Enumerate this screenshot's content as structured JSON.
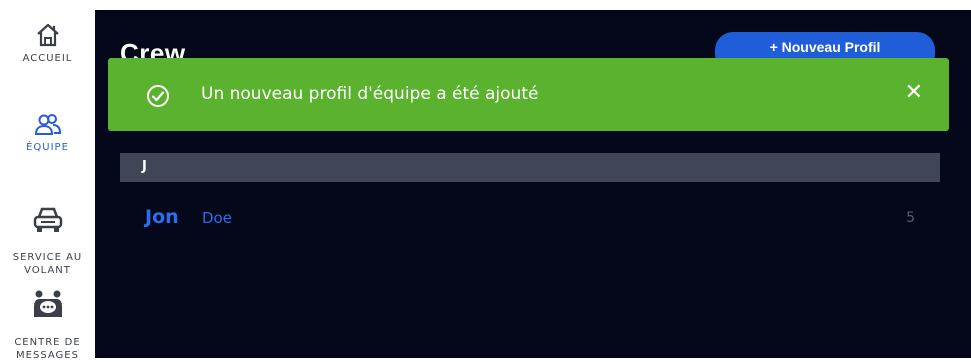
{
  "sidebar": {
    "items": [
      {
        "label": "ACCUEIL",
        "icon": "home-icon"
      },
      {
        "label": "ÉQUIPE",
        "icon": "team-icon",
        "active": true
      },
      {
        "label": "SERVICE AU\nVOLANT",
        "icon": "car-icon"
      },
      {
        "label": "CENTRE DE\nMESSAGES",
        "icon": "message-center-icon"
      }
    ]
  },
  "header": {
    "title": "Crew",
    "new_profile_label": "+ Nouveau Profil"
  },
  "toast": {
    "message": "Un nouveau profil d'équipe a été ajouté",
    "close_label": "✕",
    "color": "#5bb22e"
  },
  "list": {
    "section_letter": "J",
    "rows": [
      {
        "first_name": "Jon",
        "last_name": "Doe",
        "count": "5"
      }
    ]
  },
  "colors": {
    "background": "#05081a",
    "accent": "#1f5ed8",
    "link": "#2a6ef0",
    "section_header": "#404655"
  }
}
